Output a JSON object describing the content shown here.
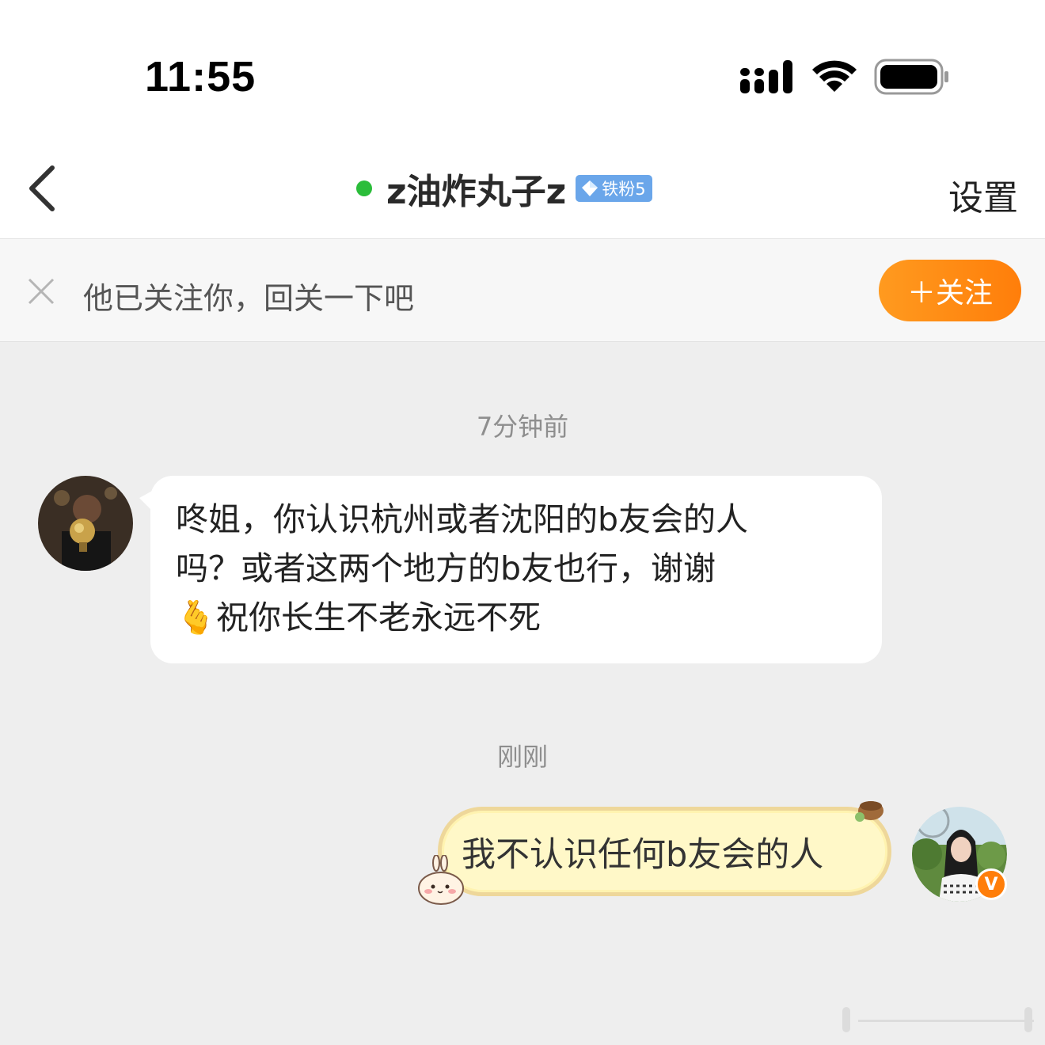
{
  "status_bar": {
    "time": "11:55",
    "icons": [
      "signal-icon",
      "wifi-icon",
      "battery-icon"
    ]
  },
  "header": {
    "title": "z油炸丸子z",
    "badge": "铁粉5",
    "settings_label": "设置",
    "online_color": "#2bbd3a"
  },
  "banner": {
    "text": "他已关注你，回关一下吧",
    "follow_label": "＋关注",
    "accent": "#ff8a12"
  },
  "messages": [
    {
      "timestamp": "7分钟前",
      "sender": "other",
      "lines": [
        "咚姐，你认识杭州或者沈阳的b友会的人",
        "吗？或者这两个地方的b友也行，谢谢",
        "🫰祝你长生不老永远不死"
      ]
    },
    {
      "timestamp": "刚刚",
      "sender": "self",
      "text": "我不认识任何b友会的人",
      "bubble_color": "#fff8c8"
    }
  ]
}
